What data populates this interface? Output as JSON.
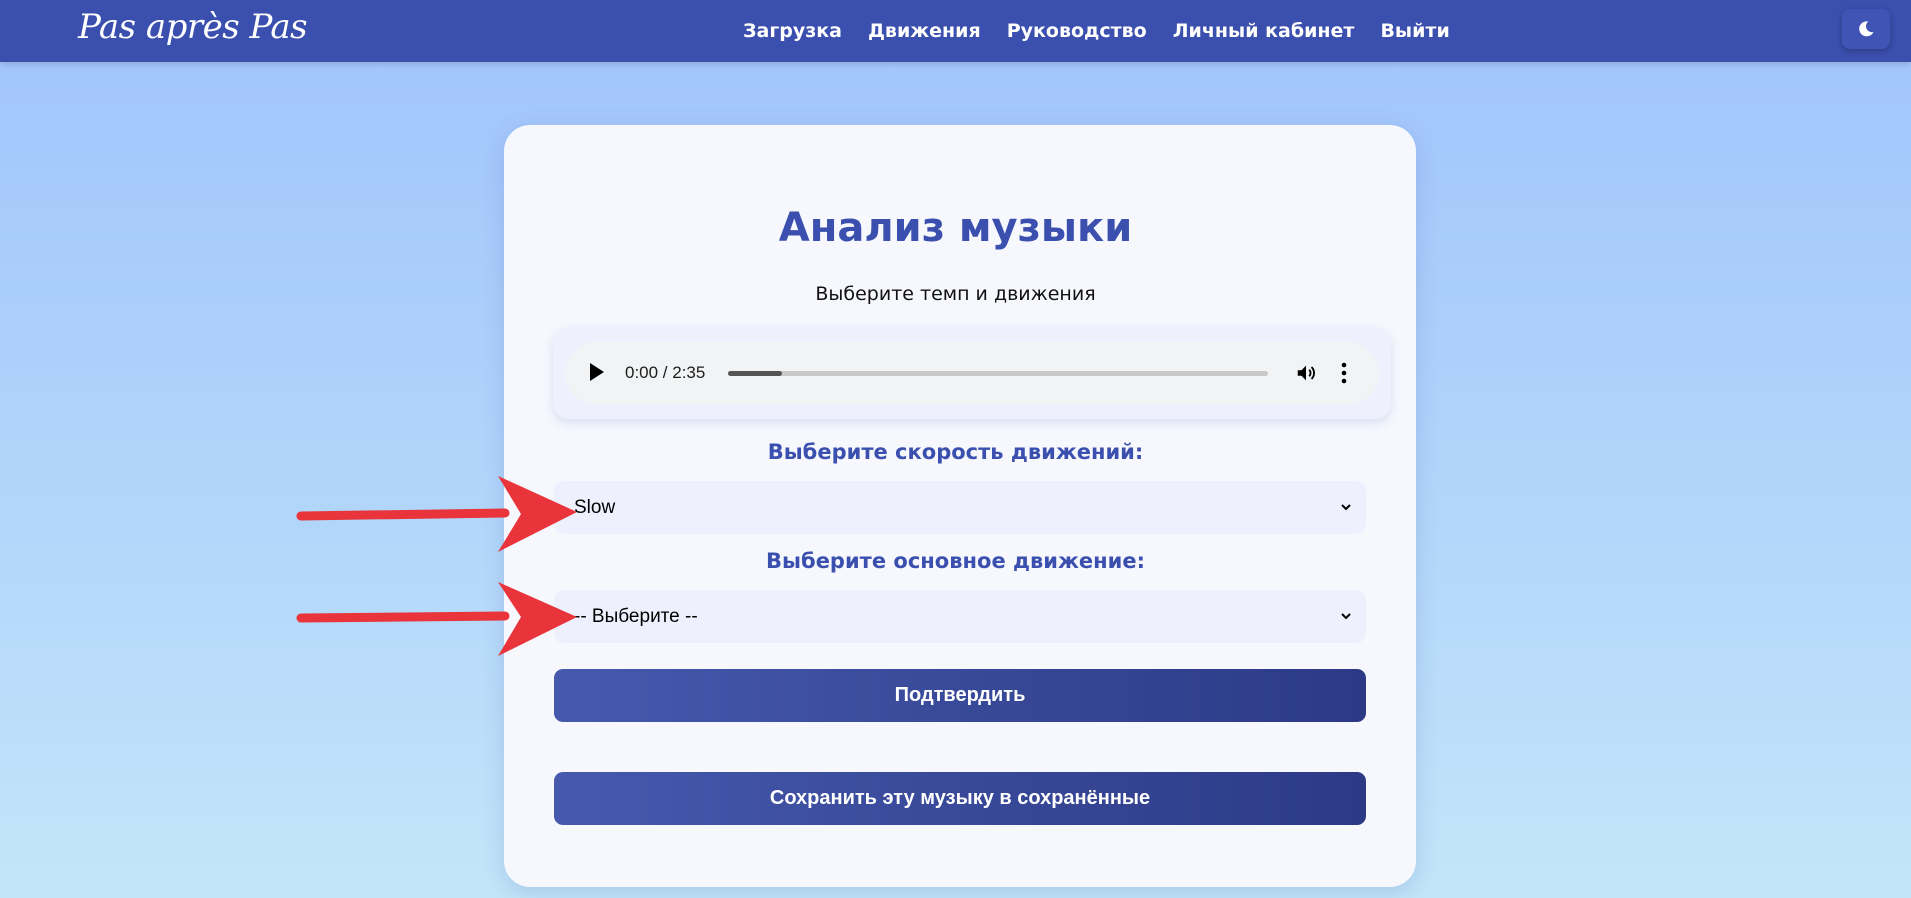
{
  "navbar": {
    "brand": "Pas après Pas",
    "links": [
      "Загрузка",
      "Движения",
      "Руководство",
      "Личный кабинет",
      "Выйти"
    ],
    "theme_toggle_icon": "moon-icon"
  },
  "card": {
    "title": "Анализ музыки",
    "subtitle": "Выберите темп и движения",
    "audio": {
      "time": "0:00 / 2:35",
      "progress_fraction": 0.1
    },
    "speed": {
      "label": "Выберите скорость движений:",
      "selected": "Slow"
    },
    "movement": {
      "label": "Выберите основное движение:",
      "selected": "-- Выберите --"
    },
    "confirm_button": "Подтвердить",
    "save_button": "Сохранить эту музыку в сохранённые"
  },
  "colors": {
    "accent": "#3a4fae",
    "annotation_arrow": "#e8343a"
  }
}
